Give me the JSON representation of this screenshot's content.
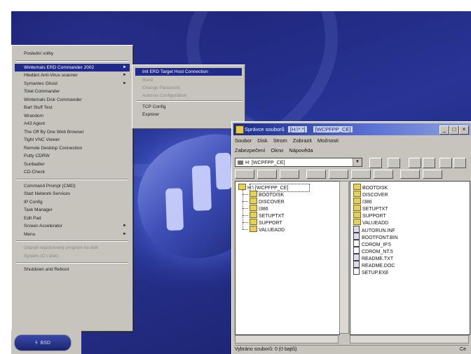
{
  "start_menu": {
    "items": [
      {
        "label": "Poslední volby",
        "top": 1
      },
      {
        "label": "Winternals ERD Commander 2002",
        "arrow": "►",
        "selected": true
      },
      {
        "label": "Hledání Anti-Virus scanner",
        "arrow": "►"
      },
      {
        "label": "Symantec Ghost",
        "arrow": "►"
      },
      {
        "label": "Total Commander"
      },
      {
        "label": "Winternals Disk Commander"
      },
      {
        "label": "Bart Stuff Test"
      },
      {
        "label": "Wrandom"
      },
      {
        "label": "A43 Agent"
      },
      {
        "label": "The Off By One Web Browser"
      },
      {
        "label": "Tight VNC Viewer"
      },
      {
        "label": "Remote Desktop Connection"
      },
      {
        "label": "Putty CDRW"
      },
      {
        "label": "Sunbadler"
      },
      {
        "label": "CD-Check"
      },
      {
        "label": "Command Prompt (CMD)"
      },
      {
        "label": "Start Network Services"
      },
      {
        "label": "IP Config"
      },
      {
        "label": "Task Manager"
      },
      {
        "label": "Edit Pad"
      },
      {
        "label": "Screen Accelerator",
        "arrow": "►"
      },
      {
        "label": "Menu",
        "arrow": "►"
      },
      {
        "label": "Odpojit registrovaný program na disk",
        "disabled": true
      },
      {
        "label": "Systém (C:\\ disk)",
        "disabled": true
      },
      {
        "label": "Shutdown and Reboot"
      }
    ]
  },
  "submenu": {
    "items": [
      {
        "label": "Init ERD Target Host Connection",
        "selected": true
      },
      {
        "label": "Run2",
        "disabled": true
      },
      {
        "label": "Change Password",
        "disabled": true
      },
      {
        "label": "Autorun Configuration",
        "disabled": true
      },
      {
        "label": "TCP Config"
      },
      {
        "label": "Explorer"
      }
    ]
  },
  "taskbar": {
    "start_label": "BSD"
  },
  "window": {
    "title_prefix": "Správce souborů",
    "title_mid": "[H:\\*.*]",
    "title_hl": "[WCPFPP_CE]",
    "menu": [
      "Soubor",
      "Disk",
      "Strom",
      "Zobrazit",
      "Možnosti"
    ],
    "menu2": [
      "Zabezpečení",
      "Okno",
      "Nápověda"
    ],
    "drive_label": "H: [WCPFPP_CE]",
    "minimize": "_",
    "maximize": "□",
    "close": "×",
    "tree": [
      {
        "label": "H:\\ [WCPFPP_CE]",
        "root": true
      },
      {
        "label": "BOOTDISK"
      },
      {
        "label": "DISCOVER"
      },
      {
        "label": "I386"
      },
      {
        "label": "SETUPTXT"
      },
      {
        "label": "SUPPORT"
      },
      {
        "label": "VALUEADD"
      }
    ],
    "files": [
      {
        "label": "BOOTDISK",
        "kind": "folder"
      },
      {
        "label": "DISCOVER",
        "kind": "folder"
      },
      {
        "label": "I386",
        "kind": "folder"
      },
      {
        "label": "SETUPTXT",
        "kind": "folder"
      },
      {
        "label": "SUPPORT",
        "kind": "folder"
      },
      {
        "label": "VALUEADD",
        "kind": "folder"
      },
      {
        "label": "AUTORUN.INF",
        "kind": "sys"
      },
      {
        "label": "BOOTFONT.BIN",
        "kind": "sys"
      },
      {
        "label": "CDROM_IP.5",
        "kind": "file"
      },
      {
        "label": "CDROM_NT.5",
        "kind": "file"
      },
      {
        "label": "README.TXT",
        "kind": "sys"
      },
      {
        "label": "README.DOC",
        "kind": "sys"
      },
      {
        "label": "SETUP.EXE",
        "kind": "file"
      }
    ],
    "status_left": "Vybráno souborů: 0 (0 bajtů)",
    "status_right": "Ce"
  }
}
